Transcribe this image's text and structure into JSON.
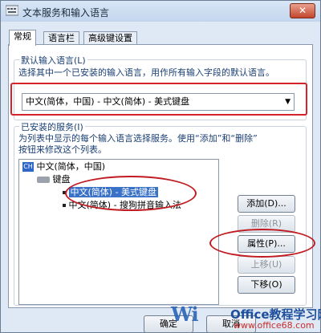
{
  "window": {
    "title": "文本服务和输入语言",
    "close_label": "✕"
  },
  "tabs": [
    {
      "label": "常规"
    },
    {
      "label": "语言栏"
    },
    {
      "label": "高级键设置"
    }
  ],
  "default_input": {
    "group_label": "默认输入语言(L)",
    "description": "选择其中一个已安装的输入语言，用作所有输入字段的默认语言。",
    "selected_value": "中文(简体，中国) - 中文(简体) - 美式键盘",
    "arrow": "▼"
  },
  "installed_services": {
    "group_label": "已安装的服务(I)",
    "description_line1": "为列表中显示的每个输入语言选择服务。使用“添加”和“删除”",
    "description_line2": "按钮来修改这个列表。",
    "tree": {
      "language_icon": "CH",
      "language": "中文(简体，中国)",
      "category": "键盘",
      "items": [
        "中文(简体) - 美式键盘",
        "中文(简体) - 搜狗拼音输入法"
      ]
    },
    "buttons": {
      "add": "添加(D)...",
      "remove": "删除(R)",
      "properties": "属性(P)...",
      "move_up": "上移(U)",
      "move_down": "下移(O)"
    }
  },
  "footer": {
    "ok": "确定",
    "cancel": "取消"
  },
  "watermark": {
    "brand_left": "Wi",
    "brand_right": "Office教程学习网",
    "url": "www.office68.com"
  },
  "colors": {
    "highlight": "#d4232a",
    "selection": "#3a72c7"
  }
}
